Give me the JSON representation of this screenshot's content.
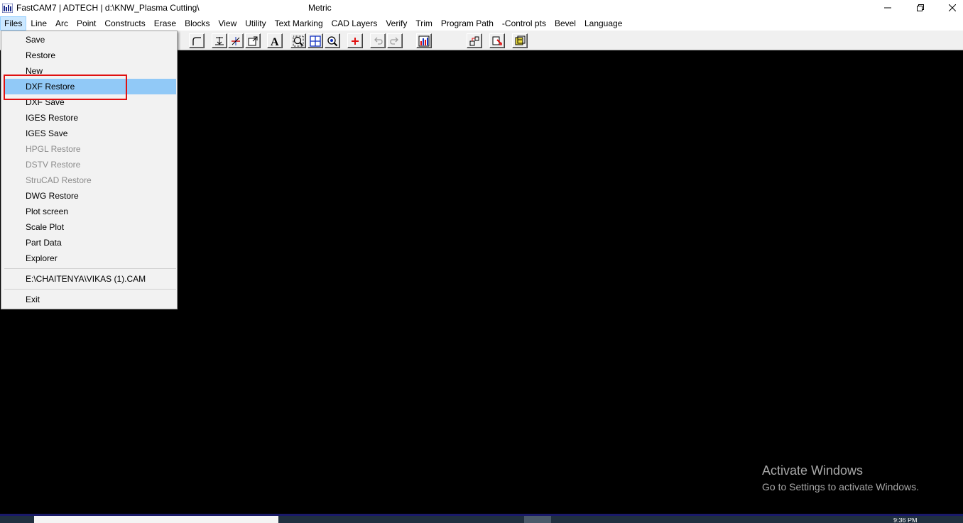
{
  "window": {
    "title": "FastCAM7  |  ADTECH  |  d:\\KNW_Plasma Cutting\\",
    "unit": "Metric",
    "controls": [
      "minimize-icon",
      "restore-icon",
      "close-icon"
    ]
  },
  "menubar": {
    "items": [
      {
        "label": "Files",
        "active": true
      },
      {
        "label": "Line"
      },
      {
        "label": "Arc"
      },
      {
        "label": "Point"
      },
      {
        "label": "Constructs"
      },
      {
        "label": "Erase"
      },
      {
        "label": "Blocks"
      },
      {
        "label": "View"
      },
      {
        "label": "Utility"
      },
      {
        "label": "Text Marking"
      },
      {
        "label": "CAD Layers"
      },
      {
        "label": "Verify"
      },
      {
        "label": "Trim"
      },
      {
        "label": "Program Path"
      },
      {
        "label": "-Control pts"
      },
      {
        "label": "Bevel"
      },
      {
        "label": "Language"
      }
    ]
  },
  "toolbar": {
    "text_tool_glyph": "A",
    "buttons": [
      "fillet-icon",
      "dimension-icon",
      "measure-icon",
      "insert-block-icon",
      "text-icon",
      "zoom-window-icon",
      "zoom-all-icon",
      "zoom-icon",
      "add-point-icon",
      "undo-icon",
      "redo-icon",
      "chart-icon",
      "path-icon",
      "verify-icon",
      "bevel-icon"
    ]
  },
  "files_menu": {
    "items": [
      {
        "label": "Save",
        "enabled": true
      },
      {
        "label": "Restore",
        "enabled": true
      },
      {
        "label": "New",
        "enabled": true
      },
      {
        "label": "DXF Restore",
        "enabled": true,
        "highlighted": true
      },
      {
        "label": "DXF Save",
        "enabled": true
      },
      {
        "label": "IGES Restore",
        "enabled": true
      },
      {
        "label": "IGES Save",
        "enabled": true
      },
      {
        "label": "HPGL Restore",
        "enabled": false
      },
      {
        "label": "DSTV Restore",
        "enabled": false
      },
      {
        "label": "StruCAD Restore",
        "enabled": false
      },
      {
        "label": "DWG Restore",
        "enabled": true
      },
      {
        "label": "Plot screen",
        "enabled": true
      },
      {
        "label": "Scale Plot",
        "enabled": true
      },
      {
        "label": "Part Data",
        "enabled": true
      },
      {
        "label": "Explorer",
        "enabled": true
      }
    ],
    "recent_file": "E:\\CHAITENYA\\VIKAS (1).CAM",
    "exit_label": "Exit"
  },
  "watermark": {
    "line1": "Activate Windows",
    "line2": "Go to Settings to activate Windows."
  },
  "taskbar": {
    "clock": "9:36 PM"
  },
  "colors": {
    "canvas": "#000000",
    "menu_hover": "#91c9f7",
    "annotation_box": "#e01010"
  }
}
